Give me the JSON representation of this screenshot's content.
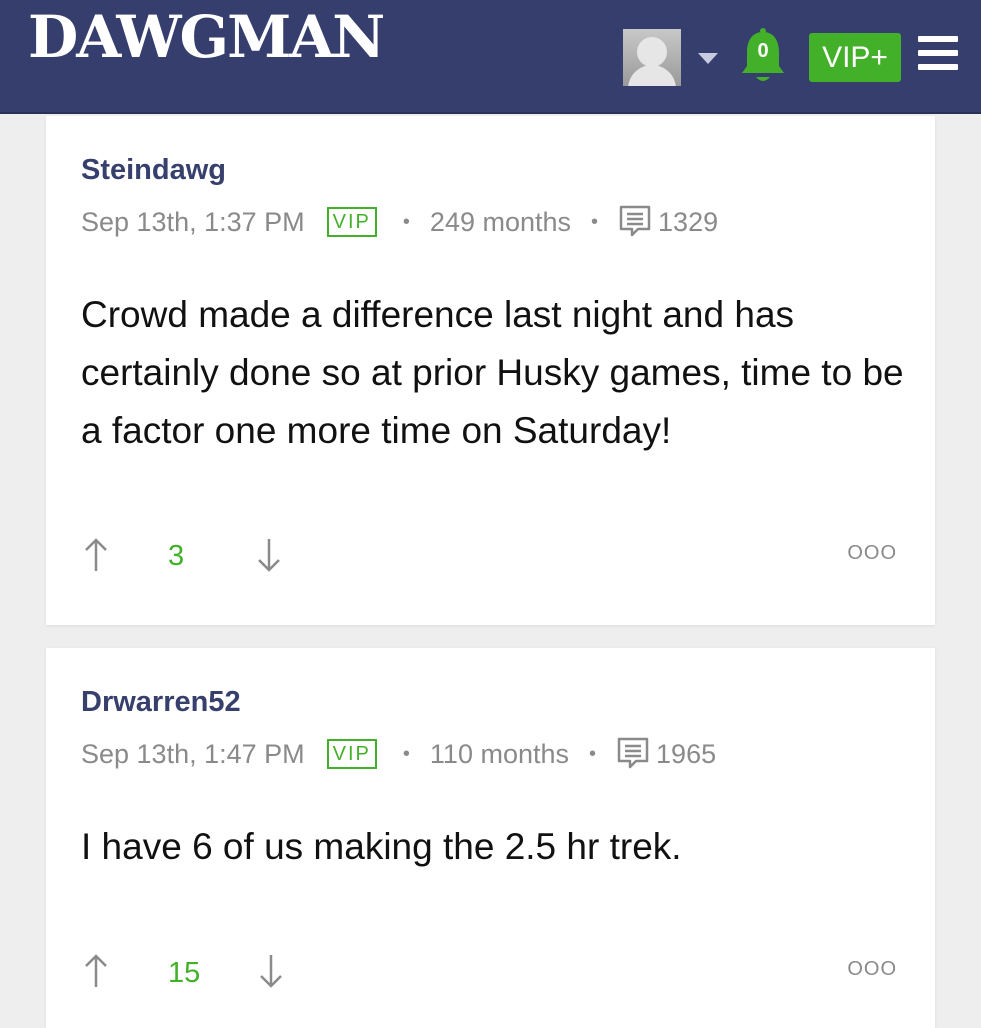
{
  "header": {
    "logo": "DAWGMAN",
    "notification_count": "0",
    "vip_button": "VIP+",
    "colors": {
      "bar": "#363e6e",
      "accent": "#43b02a"
    }
  },
  "posts": [
    {
      "username": "Steindawg",
      "date": "Sep 13th, 1:37 PM",
      "badge": "VIP",
      "membership": "249 months",
      "post_count": "1329",
      "body": "Crowd made a difference last night and has certainly done so at prior Husky games, time to be a factor one more time on Saturday!",
      "score": "3",
      "more": "OOO"
    },
    {
      "username": "Drwarren52",
      "date": "Sep 13th, 1:47 PM",
      "badge": "VIP",
      "membership": "110 months",
      "post_count": "1965",
      "body": "I have 6 of us making the 2.5 hr trek.",
      "score": "15",
      "more": "OOO"
    }
  ]
}
